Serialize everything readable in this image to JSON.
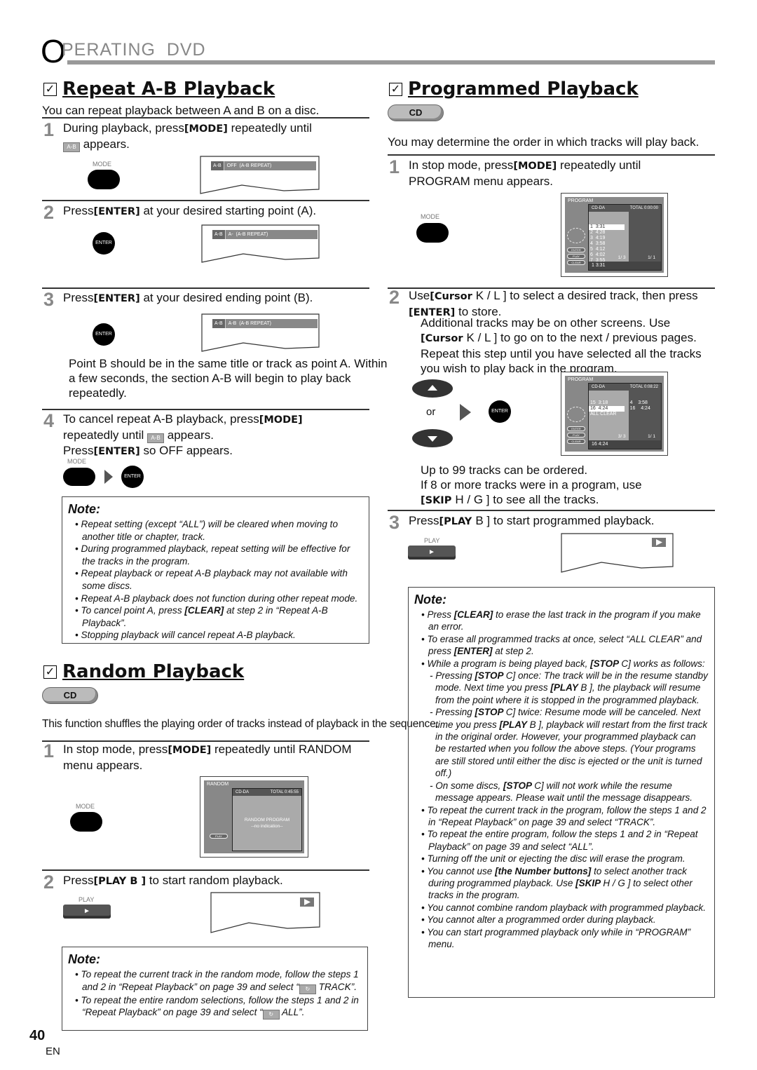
{
  "header": {
    "letter": "O",
    "rest": "PERATING  DVD"
  },
  "ab": {
    "title": "Repeat A-B Playback",
    "intro": "You can repeat playback between A and B on a disc.",
    "steps": [
      {
        "num": "1",
        "segs": [
          {
            "t": "During playback, press"
          },
          {
            "t": "[MODE]",
            "b": true
          },
          {
            "t": " repeatedly until"
          },
          {
            "br": true
          },
          {
            "icon": "A-B"
          },
          {
            "t": "  appears."
          }
        ]
      },
      {
        "num": "2",
        "segs": [
          {
            "t": "Press"
          },
          {
            "t": "[ENTER]",
            "b": true
          },
          {
            "t": " at your desired starting point (A)."
          }
        ]
      },
      {
        "num": "3",
        "segs": [
          {
            "t": "Press"
          },
          {
            "t": "[ENTER]",
            "b": true
          },
          {
            "t": " at your desired ending point (B)."
          }
        ]
      },
      {
        "num": "4",
        "segs": [
          {
            "t": "To cancel repeat A-B playback, press"
          },
          {
            "t": "[MODE]",
            "b": true
          },
          {
            "br": true
          },
          {
            "t": "repeatedly until "
          },
          {
            "icon": "A-B"
          },
          {
            "t": " appears."
          },
          {
            "br": true
          },
          {
            "t": "Press"
          },
          {
            "t": "[ENTER]",
            "b": true
          },
          {
            "t": " so  OFF  appears."
          }
        ]
      }
    ],
    "screens": [
      "OFF  (A-B REPEAT)",
      "A-  (A-B REPEAT)",
      "A-B  (A-B REPEAT)"
    ],
    "point_b": "Point B should be in the same title or track as point A. Within a few seconds, the section A-B will begin to play back repeatedly.",
    "note_title": "Note:",
    "notes": [
      [
        {
          "t": "Repeat setting (except “ALL”) will be cleared when moving to another title or chapter, track."
        }
      ],
      [
        {
          "t": "During programmed playback, repeat setting will be effective for the tracks in the program."
        }
      ],
      [
        {
          "t": "Repeat playback or repeat A-B playback may not available with some discs."
        }
      ],
      [
        {
          "t": "Repeat A-B playback does not function during other repeat mode."
        }
      ],
      [
        {
          "t": "To cancel point A, press "
        },
        {
          "t": "[CLEAR]",
          "b": true
        },
        {
          "t": " at step 2 in “Repeat A-B Playback”."
        }
      ],
      [
        {
          "t": "Stopping playback will cancel repeat A-B playback."
        }
      ]
    ]
  },
  "buttons": {
    "mode": "MODE",
    "enter": "ENTER",
    "play": "PLAY",
    "play_glyph": "►",
    "or": "or"
  },
  "random": {
    "title": "Random Playback",
    "badge": "CD",
    "intro": "This function shuffles the playing order of tracks instead of playback in the sequence.",
    "steps": [
      {
        "num": "1",
        "segs": [
          {
            "t": "In stop mode, press"
          },
          {
            "t": "[MODE]",
            "b": true
          },
          {
            "t": " repeatedly until  RANDOM"
          },
          {
            "br": true
          },
          {
            "t": "menu appears."
          }
        ]
      },
      {
        "num": "2",
        "segs": [
          {
            "t": "Press"
          },
          {
            "t": "[PLAY B ]",
            "b": true
          },
          {
            "t": " to start random playback."
          }
        ]
      }
    ],
    "screen": {
      "title": "RANDOM",
      "disc": "CD-DA",
      "total": "TOTAL 0:45:55",
      "line1": "RANDOM PROGRAM",
      "line2": "--no indication--",
      "play": "PLAY"
    },
    "note_title": "Note:",
    "notes": [
      [
        {
          "t": "To repeat the current track in the random mode, follow the steps 1 and 2 in “Repeat Playback” on page 39 and select “"
        },
        {
          "icon": "↻"
        },
        {
          "t": " TRACK”."
        }
      ],
      [
        {
          "t": "To repeat the entire random selections, follow the steps 1 and 2 in “Repeat Playback” on page 39 and select “"
        },
        {
          "icon": "↻"
        },
        {
          "t": " ALL”."
        }
      ]
    ]
  },
  "prog": {
    "title": "Programmed Playback",
    "badge": "CD",
    "intro": "You may determine the order in which tracks will play back.",
    "steps": [
      {
        "num": "1",
        "segs": [
          {
            "t": "In stop mode, press"
          },
          {
            "t": "[MODE]",
            "b": true
          },
          {
            "t": " repeatedly until"
          },
          {
            "br": true
          },
          {
            "t": " PROGRAM  menu appears."
          }
        ]
      },
      {
        "num": "2",
        "segs": [
          {
            "t": "Use"
          },
          {
            "t": "[Cursor ",
            "b": true
          },
          {
            "t": "K / L ] to select a desired track, then press"
          },
          {
            "br": true
          },
          {
            "t": "[ENTER]",
            "b": true
          },
          {
            "t": " to store."
          }
        ]
      },
      {
        "num": "3",
        "segs": [
          {
            "t": "Press"
          },
          {
            "t": "[PLAY ",
            "b": true
          },
          {
            "t": "B ] to start programmed playback."
          }
        ]
      }
    ],
    "step2_extra": [
      {
        "t": "Additional tracks may be on other screens. Use"
      },
      {
        "br": true
      },
      {
        "t": "[Cursor ",
        "b": true
      },
      {
        "t": "K / L ] to go on to the next / previous pages."
      },
      {
        "br": true
      },
      {
        "t": "Repeat this step until you have selected all the tracks"
      },
      {
        "br": true
      },
      {
        "t": "you wish to play back in the program."
      }
    ],
    "tracks_para": [
      {
        "t": "Up to 99 tracks can be ordered."
      },
      {
        "br": true
      },
      {
        "t": "If 8 or more tracks were in a program, use"
      },
      {
        "br": true
      },
      {
        "t": "[SKIP ",
        "b": true
      },
      {
        "t": "H  / G  ] to see all the tracks."
      }
    ],
    "screen1": {
      "title": "PROGRAM",
      "disc": "CD-DA",
      "total": "TOTAL   0:00:00",
      "tracks": [
        "1  3:31",
        "2  4:28",
        "3  4:19",
        "4  3:58",
        "5  4:12",
        "6  4:02",
        "7  3:55"
      ],
      "page_l": "1/  3",
      "page_r": "1/  1",
      "footer": "1  3:31"
    },
    "screen2": {
      "title": "PROGRAM",
      "disc": "CD-DA",
      "total": "TOTAL   0:08:22",
      "tracks": [
        "15  3:18",
        "16  4:24",
        "ALL CLEAR"
      ],
      "prog": [
        "4    3:58",
        "16    4:24"
      ],
      "page_l": "3/  3",
      "page_r": "1/  1",
      "footer": "16  4:24"
    },
    "osd_buttons": [
      "ENTER",
      "PLAY",
      "CLEAR"
    ],
    "note_title": "Note:",
    "notes": [
      [
        {
          "t": "Press "
        },
        {
          "t": "[CLEAR]",
          "b": true
        },
        {
          "t": " to erase the last track in the program if you make an error."
        }
      ],
      [
        {
          "t": "To erase all programmed tracks at once, select “ALL CLEAR” and press "
        },
        {
          "t": "[ENTER]",
          "b": true
        },
        {
          "t": " at step 2."
        }
      ],
      [
        {
          "t": "While a program is being played back, "
        },
        {
          "t": "[STOP ",
          "b": true
        },
        {
          "t": "C] works as follows:"
        }
      ],
      {
        "sub": true,
        "segs": [
          {
            "t": "- Pressing "
          },
          {
            "t": "[STOP ",
            "b": true
          },
          {
            "t": "C] once: The track will be in the resume standby mode. Next time you press "
          },
          {
            "t": "[PLAY ",
            "b": true
          },
          {
            "t": "B ], the playback will resume from the point where it is stopped in the programmed playback."
          }
        ]
      },
      {
        "sub": true,
        "segs": [
          {
            "t": "- Pressing "
          },
          {
            "t": "[STOP ",
            "b": true
          },
          {
            "t": "C] twice: Resume mode will be canceled. Next time you press "
          },
          {
            "t": "[PLAY ",
            "b": true
          },
          {
            "t": "B ], playback will restart from the first track in the original order. However, your programmed playback can be restarted when you follow the above steps. (Your programs are still stored until either the disc is ejected or the unit is turned off.)"
          }
        ]
      },
      {
        "sub": true,
        "segs": [
          {
            "t": "- On some discs, "
          },
          {
            "t": "[STOP ",
            "b": true
          },
          {
            "t": "C] will not work while the resume message appears. Please wait until the message disappears."
          }
        ]
      },
      [
        {
          "t": "To repeat the current track in the program, follow the steps 1 and 2 in “Repeat Playback” on page 39 and select “TRACK”."
        }
      ],
      [
        {
          "t": "To repeat the entire program, follow the steps 1 and 2 in “Repeat Playback” on page 39 and select “ALL”."
        }
      ],
      [
        {
          "t": "Turning off the unit or ejecting the disc will erase the program."
        }
      ],
      [
        {
          "t": "You cannot use "
        },
        {
          "t": "[the Number buttons]",
          "b": true
        },
        {
          "t": " to select another track during programmed playback. Use "
        },
        {
          "t": "[SKIP ",
          "b": true
        },
        {
          "t": "H  / G  ] to select other tracks in the program."
        }
      ],
      [
        {
          "t": "You cannot combine random playback with programmed playback."
        }
      ],
      [
        {
          "t": "You cannot alter a programmed order during playback."
        }
      ],
      [
        {
          "t": "You can start programmed playback only while in “PROGRAM” menu."
        }
      ]
    ]
  },
  "footer": {
    "page": "40",
    "lang": "EN"
  }
}
